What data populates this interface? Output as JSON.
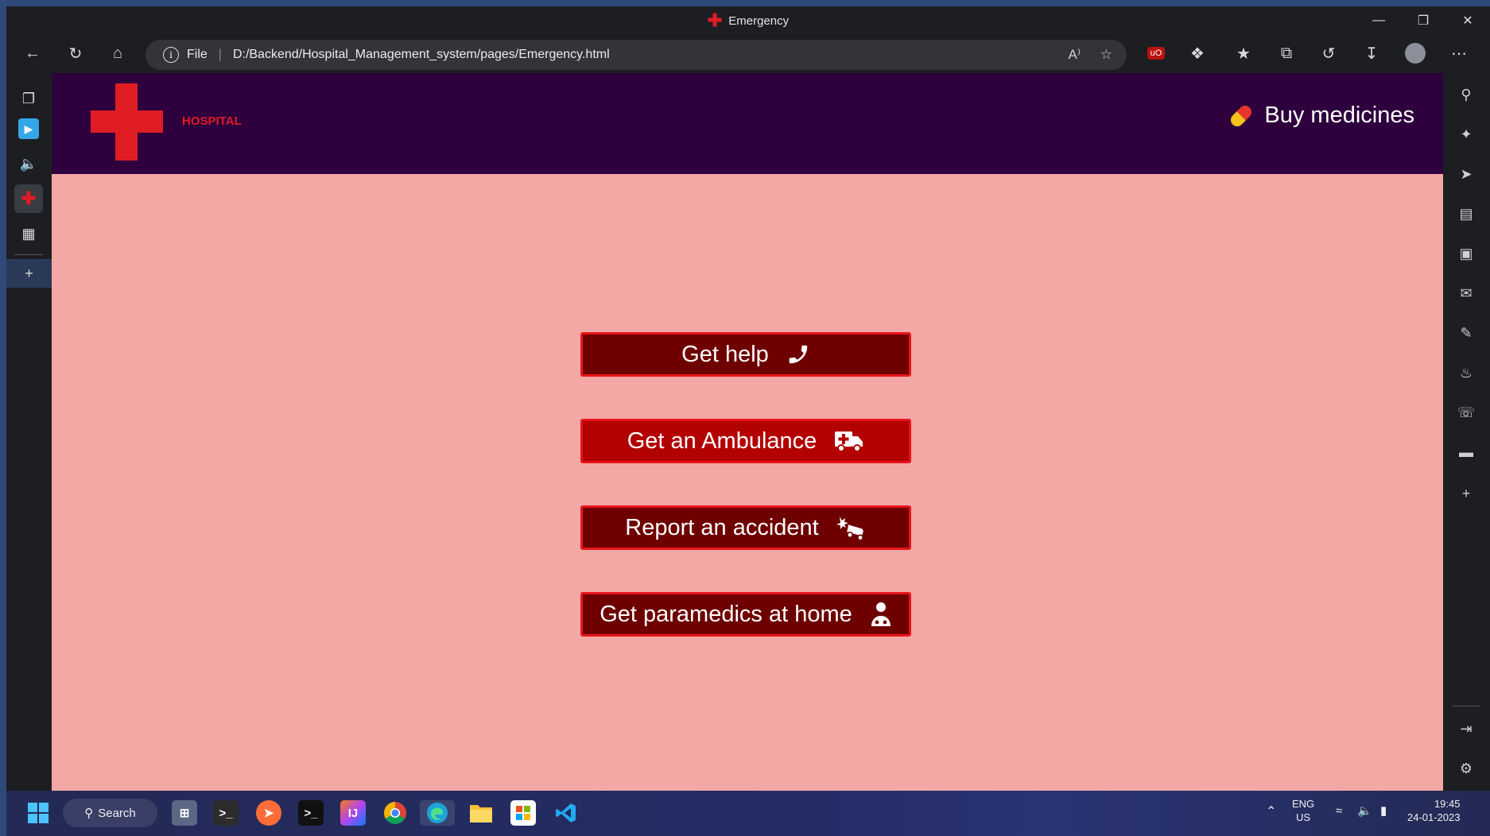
{
  "window": {
    "title": "Emergency"
  },
  "window_controls": [
    "minimize",
    "restore",
    "close"
  ],
  "address_bar": {
    "scheme_label": "File",
    "url": "D:/Backend/Hospital_Management_system/pages/Emergency.html"
  },
  "page": {
    "brand": "HOSPITAL",
    "buy_link": "Buy medicines",
    "buttons": [
      {
        "label": "Get help",
        "icon": "phone-icon"
      },
      {
        "label": "Get an Ambulance",
        "icon": "ambulance-icon"
      },
      {
        "label": "Report an accident",
        "icon": "car-crash-icon"
      },
      {
        "label": "Get paramedics at home",
        "icon": "doctor-icon"
      }
    ]
  },
  "taskbar": {
    "search_label": "Search",
    "lang_top": "ENG",
    "lang_bottom": "US",
    "time": "19:45",
    "date": "24-01-2023"
  },
  "colors": {
    "header": "#2e003d",
    "page_bg": "#f4a8a6",
    "button_dark": "#6e0000",
    "button_red": "#b30000",
    "accent": "#e01c24"
  }
}
